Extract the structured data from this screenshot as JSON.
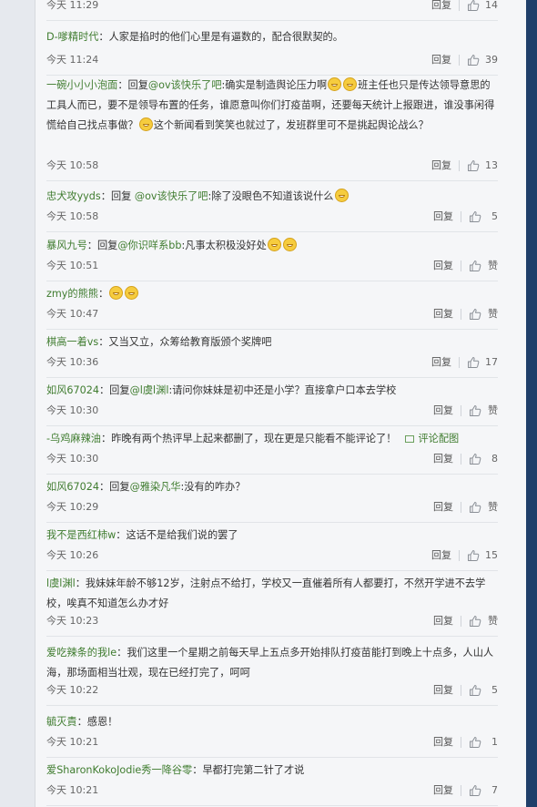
{
  "labels": {
    "reply": "回复",
    "like": "赞"
  },
  "comments": [
    {
      "user": "",
      "segments": [],
      "time": "今天 11:29",
      "likes": "14"
    },
    {
      "user": "D-嗲精时代",
      "segments": [
        {
          "t": "text",
          "v": "人家是掐时的他们心里是有逼数的，配合很默契的。"
        }
      ],
      "time": "今天 11:24",
      "likes": "39"
    },
    {
      "user": "一碗小小小泡面",
      "segments": [
        {
          "t": "text",
          "v": "回复"
        },
        {
          "t": "mention",
          "v": "@ov该快乐了吧"
        },
        {
          "t": "text",
          "v": ":确实是制造舆论压力啊"
        },
        {
          "t": "emoji",
          "v": "laugh-emoji"
        },
        {
          "t": "emoji",
          "v": "laugh-emoji"
        },
        {
          "t": "text",
          "v": "班主任也只是传达领导意思的工具人而已，要不是领导布置的任务，谁愿意叫你们打疫苗啊，还要每天统计上报跟进，谁没事闲得慌给自己找点事做？"
        },
        {
          "t": "emoji",
          "v": "laugh-emoji"
        },
        {
          "t": "text",
          "v": "这个新闻看到笑笑也就过了，发班群里可不是挑起舆论战么？"
        }
      ],
      "time": "今天 10:58",
      "likes": "13"
    },
    {
      "user": "忠犬攻yyds",
      "segments": [
        {
          "t": "text",
          "v": "回复 "
        },
        {
          "t": "mention",
          "v": "@ov该快乐了吧"
        },
        {
          "t": "text",
          "v": ":除了没眼色不知道该说什么"
        },
        {
          "t": "emoji",
          "v": "blush-emoji"
        }
      ],
      "time": "今天 10:58",
      "likes": "5"
    },
    {
      "user": "暴风九号",
      "segments": [
        {
          "t": "text",
          "v": "回复"
        },
        {
          "t": "mention",
          "v": "@你识咩系bb"
        },
        {
          "t": "text",
          "v": ":凡事太积极没好处"
        },
        {
          "t": "emoji",
          "v": "grin-emoji"
        },
        {
          "t": "emoji",
          "v": "grin-emoji"
        }
      ],
      "time": "今天 10:51",
      "likes": "赞"
    },
    {
      "user": "zmy的熊熊",
      "segments": [
        {
          "t": "emoji",
          "v": "grin-emoji"
        },
        {
          "t": "emoji",
          "v": "grin-emoji"
        }
      ],
      "time": "今天 10:47",
      "likes": "赞"
    },
    {
      "user": "棋高一着vs",
      "segments": [
        {
          "t": "text",
          "v": "又当又立，众筹给教育版颁个奖牌吧"
        }
      ],
      "time": "今天 10:36",
      "likes": "17"
    },
    {
      "user": "如风67024",
      "segments": [
        {
          "t": "text",
          "v": "回复"
        },
        {
          "t": "mention",
          "v": "@l虞l渊l"
        },
        {
          "t": "text",
          "v": ":请问你妹妹是初中还是小学？直接拿户口本去学校"
        }
      ],
      "time": "今天 10:30",
      "likes": "赞"
    },
    {
      "user": "-乌鸡麻辣油",
      "segments": [
        {
          "t": "text",
          "v": "昨晚有两个热评早上起来都删了，现在更是只能看不能评论了！"
        }
      ],
      "pic_label": "评论配图",
      "time": "今天 10:30",
      "likes": "8"
    },
    {
      "user": "如风67024",
      "segments": [
        {
          "t": "text",
          "v": "回复"
        },
        {
          "t": "mention",
          "v": "@雅染凡华"
        },
        {
          "t": "text",
          "v": ":没有的咋办？"
        }
      ],
      "time": "今天 10:29",
      "likes": "赞"
    },
    {
      "user": "我不是西红柿w",
      "segments": [
        {
          "t": "text",
          "v": "这话不是给我们说的罢了"
        }
      ],
      "time": "今天 10:26",
      "likes": "15"
    },
    {
      "user": "l虞l渊l",
      "segments": [
        {
          "t": "text",
          "v": "我妹妹年龄不够12岁，注射点不给打，学校又一直催着所有人都要打，不然开学进不去学校，唉真不知道怎么办才好"
        }
      ],
      "time": "今天 10:23",
      "likes": "赞"
    },
    {
      "user": "爱吃辣条的我le",
      "segments": [
        {
          "t": "text",
          "v": "我们这里一个星期之前每天早上五点多开始排队打疫苗能打到晚上十点多，人山人海，那场面相当壮观，现在已经打完了，呵呵"
        }
      ],
      "time": "今天 10:22",
      "likes": "5"
    },
    {
      "user": "毓灭責",
      "segments": [
        {
          "t": "text",
          "v": "感恩！"
        }
      ],
      "time": "今天 10:21",
      "likes": "1"
    },
    {
      "user": "爱SharonKokoJodie秀一降谷零",
      "segments": [
        {
          "t": "text",
          "v": "早都打完第二针了才说"
        }
      ],
      "time": "今天 10:21",
      "likes": "7"
    }
  ]
}
